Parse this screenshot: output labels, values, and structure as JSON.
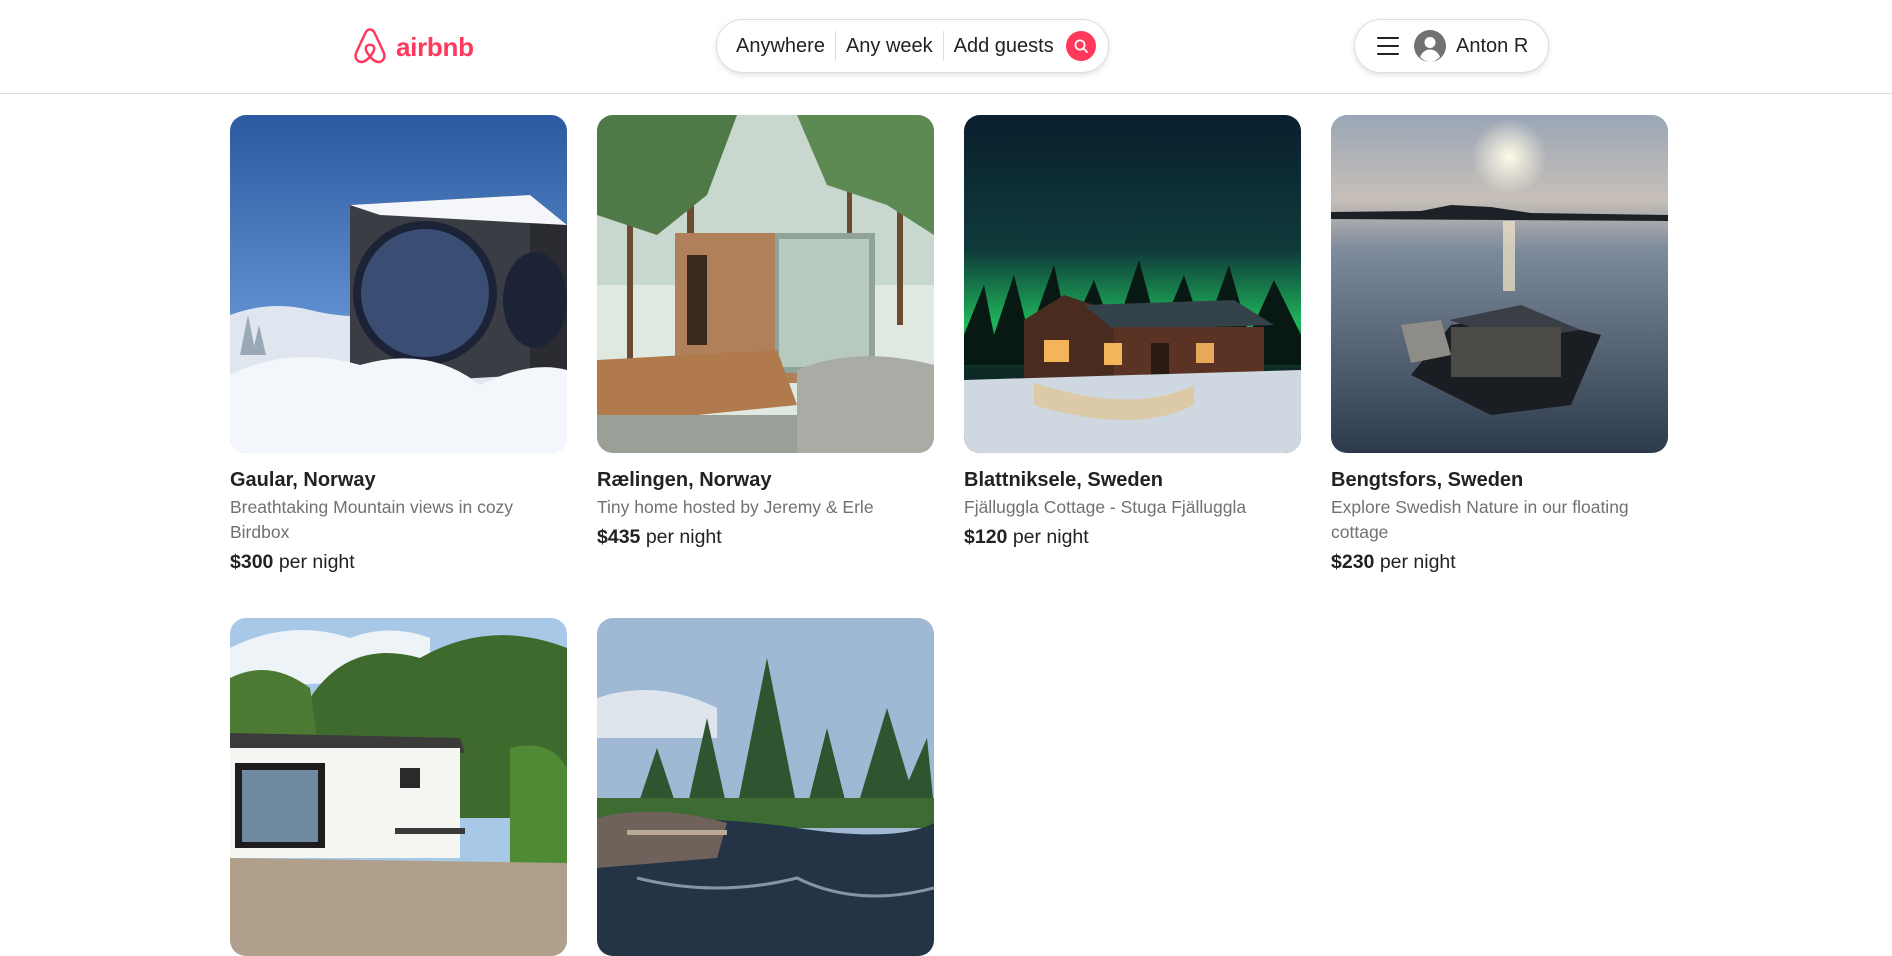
{
  "header": {
    "logo_text": "airbnb",
    "brand_color": "#ff385c",
    "search": {
      "anywhere": "Anywhere",
      "any_week": "Any week",
      "add_guests": "Add guests"
    },
    "user": {
      "name": "Anton R"
    }
  },
  "listings": [
    {
      "title": "Gaular, Norway",
      "description": "Breathtaking Mountain views in cozy Birdbox",
      "price": "$300",
      "price_suffix": "per night"
    },
    {
      "title": "Rælingen, Norway",
      "description": "Tiny home hosted by Jeremy & Erle",
      "price": "$435",
      "price_suffix": "per night"
    },
    {
      "title": "Blattniksele, Sweden",
      "description": "Fjälluggla Cottage - Stuga Fjälluggla",
      "price": "$120",
      "price_suffix": "per night"
    },
    {
      "title": "Bengtsfors, Sweden",
      "description": "Explore Swedish Nature in our floating cottage",
      "price": "$230",
      "price_suffix": "per night"
    },
    {
      "title": "",
      "description": "",
      "price": "",
      "price_suffix": ""
    },
    {
      "title": "",
      "description": "",
      "price": "",
      "price_suffix": ""
    }
  ]
}
